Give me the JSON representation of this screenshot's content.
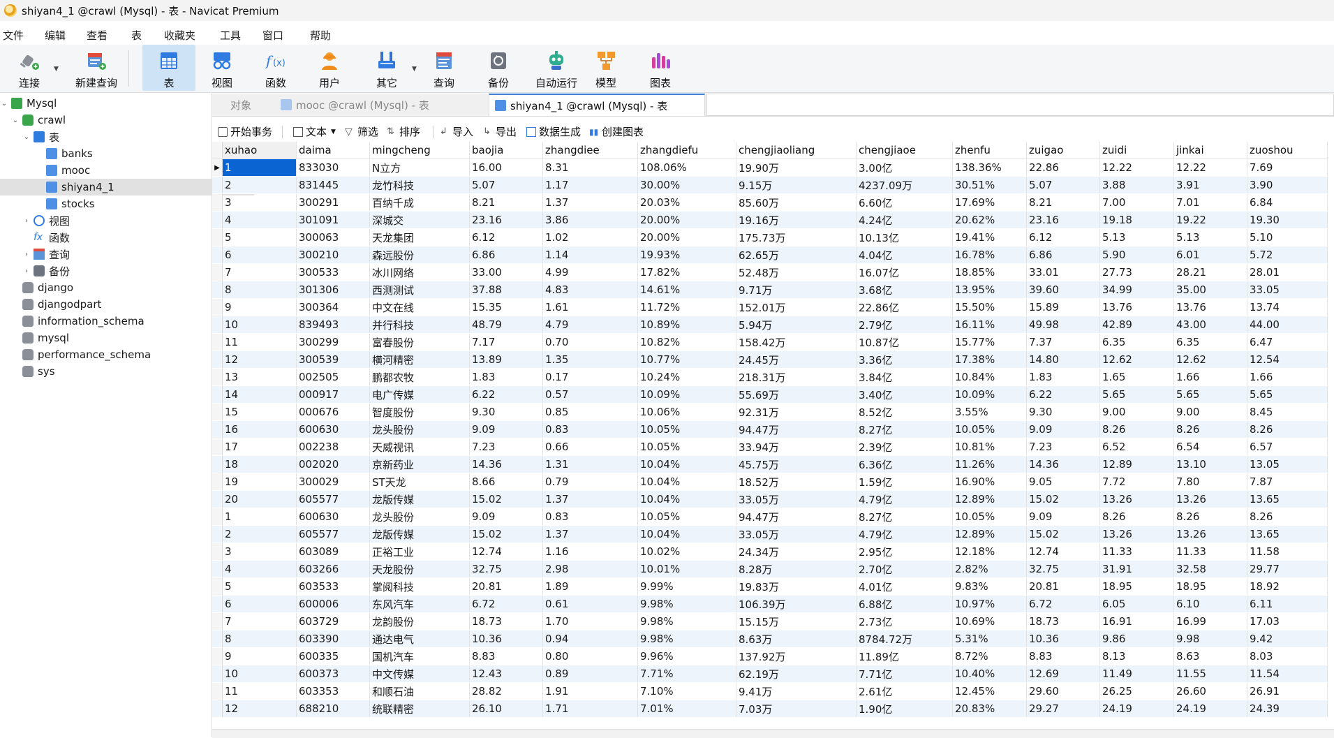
{
  "window": {
    "title": "shiyan4_1 @crawl (Mysql) - 表 - Navicat Premium"
  },
  "menu": [
    "文件",
    "编辑",
    "查看",
    "表",
    "收藏夹",
    "工具",
    "窗口",
    "帮助"
  ],
  "toolbar": {
    "connect": "连接",
    "new_query": "新建查询",
    "table": "表",
    "view": "视图",
    "function": "函数",
    "user": "用户",
    "other": "其它",
    "query": "查询",
    "backup": "备份",
    "automation": "自动运行",
    "model": "模型",
    "chart": "图表"
  },
  "tree": {
    "connection": "Mysql",
    "db_crawl": "crawl",
    "tables_group": "表",
    "tables": [
      "banks",
      "mooc",
      "shiyan4_1",
      "stocks"
    ],
    "selected_table": "shiyan4_1",
    "views_group": "视图",
    "functions_group": "函数",
    "queries_group": "查询",
    "backups_group": "备份",
    "other_dbs": [
      "django",
      "djangodpart",
      "information_schema",
      "mysql",
      "performance_schema",
      "sys"
    ]
  },
  "tabs": {
    "objects": "对象",
    "tab1": "mooc @crawl (Mysql) - 表",
    "tab2": "shiyan4_1 @crawl (Mysql) - 表"
  },
  "subtoolbar": {
    "begin_tx": "开始事务",
    "text": "文本",
    "filter": "筛选",
    "sort": "排序",
    "import": "导入",
    "export": "导出",
    "data_gen": "数据生成",
    "create_chart": "创建图表"
  },
  "colors": {
    "accent": "#0a64d2",
    "selected_tab_border": "#3d7fd6",
    "row_alt": "#eef4fc"
  },
  "grid": {
    "columns": [
      "xuhao",
      "daima",
      "mingcheng",
      "baojia",
      "zhangdiee",
      "zhangdiefu",
      "chengjiaoliang",
      "chengjiaoe",
      "zhenfu",
      "zuigao",
      "zuidi",
      "jinkai",
      "zuoshou"
    ],
    "rows": [
      [
        "1",
        "833030",
        "N立方",
        "16.00",
        "8.31",
        "108.06%",
        "19.90万",
        "3.00亿",
        "138.36%",
        "22.86",
        "12.22",
        "12.22",
        "7.69"
      ],
      [
        "2",
        "831445",
        "龙竹科技",
        "5.07",
        "1.17",
        "30.00%",
        "9.15万",
        "4237.09万",
        "30.51%",
        "5.07",
        "3.88",
        "3.91",
        "3.90"
      ],
      [
        "3",
        "300291",
        "百纳千成",
        "8.21",
        "1.37",
        "20.03%",
        "85.60万",
        "6.60亿",
        "17.69%",
        "8.21",
        "7.00",
        "7.01",
        "6.84"
      ],
      [
        "4",
        "301091",
        "深城交",
        "23.16",
        "3.86",
        "20.00%",
        "19.16万",
        "4.24亿",
        "20.62%",
        "23.16",
        "19.18",
        "19.22",
        "19.30"
      ],
      [
        "5",
        "300063",
        "天龙集团",
        "6.12",
        "1.02",
        "20.00%",
        "175.73万",
        "10.13亿",
        "19.41%",
        "6.12",
        "5.13",
        "5.13",
        "5.10"
      ],
      [
        "6",
        "300210",
        "森远股份",
        "6.86",
        "1.14",
        "19.93%",
        "62.65万",
        "4.04亿",
        "16.78%",
        "6.86",
        "5.90",
        "6.01",
        "5.72"
      ],
      [
        "7",
        "300533",
        "冰川网络",
        "33.00",
        "4.99",
        "17.82%",
        "52.48万",
        "16.07亿",
        "18.85%",
        "33.01",
        "27.73",
        "28.21",
        "28.01"
      ],
      [
        "8",
        "301306",
        "西测测试",
        "37.88",
        "4.83",
        "14.61%",
        "9.71万",
        "3.68亿",
        "13.95%",
        "39.60",
        "34.99",
        "35.00",
        "33.05"
      ],
      [
        "9",
        "300364",
        "中文在线",
        "15.35",
        "1.61",
        "11.72%",
        "152.01万",
        "22.86亿",
        "15.50%",
        "15.89",
        "13.76",
        "13.76",
        "13.74"
      ],
      [
        "10",
        "839493",
        "并行科技",
        "48.79",
        "4.79",
        "10.89%",
        "5.94万",
        "2.79亿",
        "16.11%",
        "49.98",
        "42.89",
        "43.00",
        "44.00"
      ],
      [
        "11",
        "300299",
        "富春股份",
        "7.17",
        "0.70",
        "10.82%",
        "158.42万",
        "10.87亿",
        "15.77%",
        "7.37",
        "6.35",
        "6.35",
        "6.47"
      ],
      [
        "12",
        "300539",
        "横河精密",
        "13.89",
        "1.35",
        "10.77%",
        "24.45万",
        "3.36亿",
        "17.38%",
        "14.80",
        "12.62",
        "12.62",
        "12.54"
      ],
      [
        "13",
        "002505",
        "鹏都农牧",
        "1.83",
        "0.17",
        "10.24%",
        "218.31万",
        "3.84亿",
        "10.84%",
        "1.83",
        "1.65",
        "1.66",
        "1.66"
      ],
      [
        "14",
        "000917",
        "电广传媒",
        "6.22",
        "0.57",
        "10.09%",
        "55.69万",
        "3.40亿",
        "10.09%",
        "6.22",
        "5.65",
        "5.65",
        "5.65"
      ],
      [
        "15",
        "000676",
        "智度股份",
        "9.30",
        "0.85",
        "10.06%",
        "92.31万",
        "8.52亿",
        "3.55%",
        "9.30",
        "9.00",
        "9.00",
        "8.45"
      ],
      [
        "16",
        "600630",
        "龙头股份",
        "9.09",
        "0.83",
        "10.05%",
        "94.47万",
        "8.27亿",
        "10.05%",
        "9.09",
        "8.26",
        "8.26",
        "8.26"
      ],
      [
        "17",
        "002238",
        "天威视讯",
        "7.23",
        "0.66",
        "10.05%",
        "33.94万",
        "2.39亿",
        "10.81%",
        "7.23",
        "6.52",
        "6.54",
        "6.57"
      ],
      [
        "18",
        "002020",
        "京新药业",
        "14.36",
        "1.31",
        "10.04%",
        "45.75万",
        "6.36亿",
        "11.26%",
        "14.36",
        "12.89",
        "13.10",
        "13.05"
      ],
      [
        "19",
        "300029",
        "ST天龙",
        "8.66",
        "0.79",
        "10.04%",
        "18.52万",
        "1.59亿",
        "16.90%",
        "9.05",
        "7.72",
        "7.80",
        "7.87"
      ],
      [
        "20",
        "605577",
        "龙版传媒",
        "15.02",
        "1.37",
        "10.04%",
        "33.05万",
        "4.79亿",
        "12.89%",
        "15.02",
        "13.26",
        "13.26",
        "13.65"
      ],
      [
        "1",
        "600630",
        "龙头股份",
        "9.09",
        "0.83",
        "10.05%",
        "94.47万",
        "8.27亿",
        "10.05%",
        "9.09",
        "8.26",
        "8.26",
        "8.26"
      ],
      [
        "2",
        "605577",
        "龙版传媒",
        "15.02",
        "1.37",
        "10.04%",
        "33.05万",
        "4.79亿",
        "12.89%",
        "15.02",
        "13.26",
        "13.26",
        "13.65"
      ],
      [
        "3",
        "603089",
        "正裕工业",
        "12.74",
        "1.16",
        "10.02%",
        "24.34万",
        "2.95亿",
        "12.18%",
        "12.74",
        "11.33",
        "11.33",
        "11.58"
      ],
      [
        "4",
        "603266",
        "天龙股份",
        "32.75",
        "2.98",
        "10.01%",
        "8.28万",
        "2.70亿",
        "2.82%",
        "32.75",
        "31.91",
        "32.58",
        "29.77"
      ],
      [
        "5",
        "603533",
        "掌阅科技",
        "20.81",
        "1.89",
        "9.99%",
        "19.83万",
        "4.01亿",
        "9.83%",
        "20.81",
        "18.95",
        "18.95",
        "18.92"
      ],
      [
        "6",
        "600006",
        "东风汽车",
        "6.72",
        "0.61",
        "9.98%",
        "106.39万",
        "6.88亿",
        "10.97%",
        "6.72",
        "6.05",
        "6.10",
        "6.11"
      ],
      [
        "7",
        "603729",
        "龙韵股份",
        "18.73",
        "1.70",
        "9.98%",
        "15.15万",
        "2.73亿",
        "10.69%",
        "18.73",
        "16.91",
        "16.99",
        "17.03"
      ],
      [
        "8",
        "603390",
        "通达电气",
        "10.36",
        "0.94",
        "9.98%",
        "8.63万",
        "8784.72万",
        "5.31%",
        "10.36",
        "9.86",
        "9.98",
        "9.42"
      ],
      [
        "9",
        "600335",
        "国机汽车",
        "8.83",
        "0.80",
        "9.96%",
        "137.92万",
        "11.89亿",
        "8.72%",
        "8.83",
        "8.13",
        "8.63",
        "8.03"
      ],
      [
        "10",
        "600373",
        "中文传媒",
        "12.43",
        "0.89",
        "7.71%",
        "62.19万",
        "7.71亿",
        "10.40%",
        "12.69",
        "11.49",
        "11.55",
        "11.54"
      ],
      [
        "11",
        "603353",
        "和顺石油",
        "28.82",
        "1.91",
        "7.10%",
        "9.41万",
        "2.61亿",
        "12.45%",
        "29.60",
        "26.25",
        "26.60",
        "26.91"
      ],
      [
        "12",
        "688210",
        "统联精密",
        "26.10",
        "1.71",
        "7.01%",
        "7.03万",
        "1.90亿",
        "20.83%",
        "29.27",
        "24.19",
        "24.19",
        "24.39"
      ]
    ]
  }
}
